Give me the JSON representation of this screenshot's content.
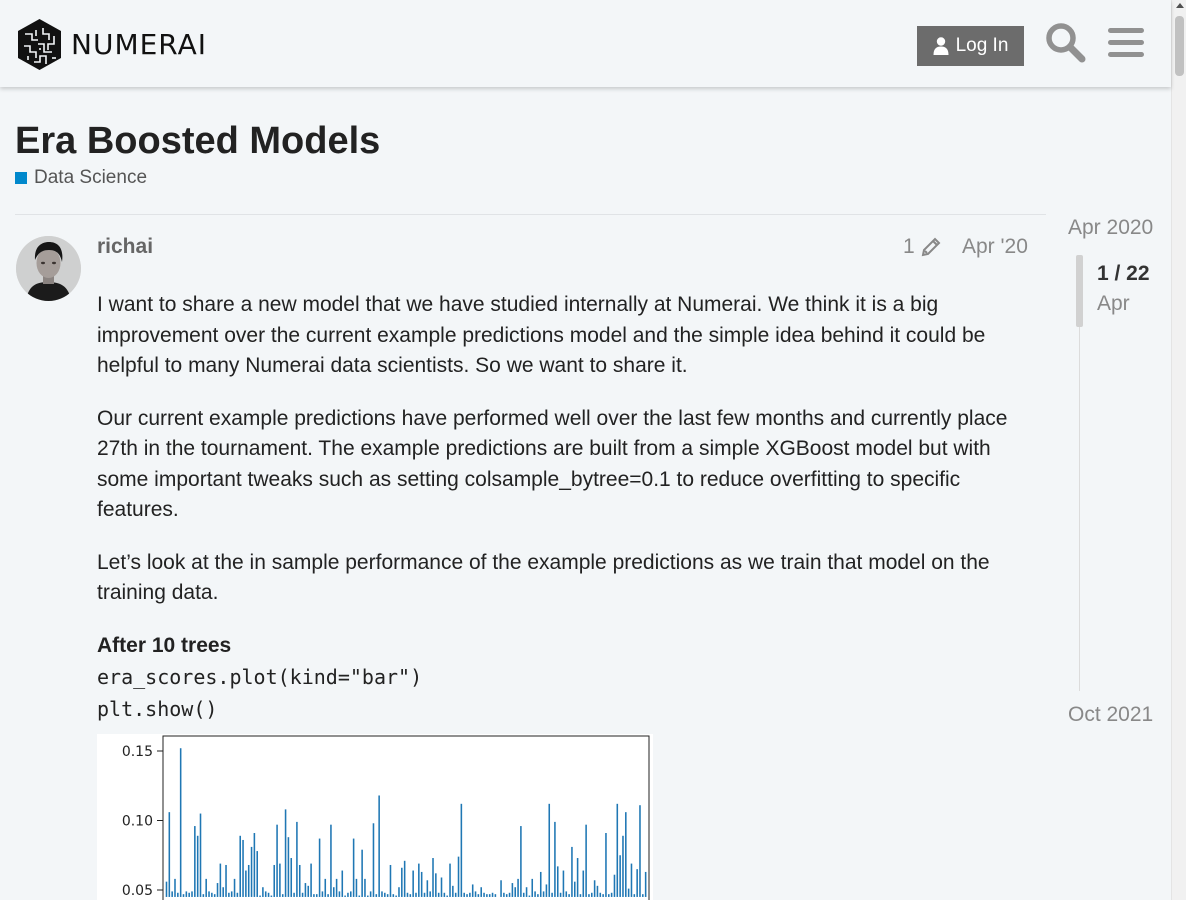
{
  "header": {
    "logo_text": "NUMERAI",
    "login_label": "Log In",
    "icons": [
      "numerai-logo-icon",
      "user-icon",
      "search-icon",
      "hamburger-menu-icon"
    ]
  },
  "topic": {
    "title": "Era Boosted Models",
    "category": "Data Science",
    "category_color": "#0088cc"
  },
  "post": {
    "username": "richai",
    "edit_count": "1",
    "date": "Apr '20",
    "paragraphs": [
      "I want to share a new model that we have studied internally at Numerai. We think it is a big improvement over the current example predictions model and the simple idea behind it could be helpful to many Numerai data scientists. So we want to share it.",
      "Our current example predictions have performed well over the last few months and currently place 27th in the tournament. The example predictions are built from a simple XGBoost model but with some important tweaks such as setting colsample_bytree=0.1 to reduce overfitting to specific features.",
      "Let’s look at the in sample performance of the example predictions as we train that model on the training data."
    ],
    "subheading": "After 10 trees",
    "code_lines": [
      "era_scores.plot(kind=\"bar\")",
      "plt.show()"
    ]
  },
  "timeline": {
    "start": "Apr 2020",
    "position": "1 / 22",
    "current_month": "Apr",
    "end": "Oct 2021"
  },
  "colors": {
    "background": "#f3f6f8",
    "button": "#6c6c6c",
    "bar": "#1f77b4"
  },
  "chart_data": {
    "type": "bar",
    "title": "",
    "xlabel": "",
    "ylabel": "",
    "ylim": [
      0.045,
      0.157
    ],
    "yticks": [
      "0.15",
      "0.10",
      "0.05"
    ],
    "values": [
      0.056,
      0.106,
      0.049,
      0.058,
      0.048,
      0.152,
      0.047,
      0.049,
      0.048,
      0.049,
      0.096,
      0.089,
      0.105,
      0.047,
      0.058,
      0.049,
      0.048,
      0.047,
      0.055,
      0.069,
      0.052,
      0.068,
      0.048,
      0.049,
      0.058,
      0.048,
      0.089,
      0.086,
      0.064,
      0.068,
      0.081,
      0.091,
      0.078,
      0.046,
      0.052,
      0.049,
      0.048,
      0.046,
      0.068,
      0.097,
      0.069,
      0.047,
      0.108,
      0.088,
      0.073,
      0.048,
      0.099,
      0.068,
      0.048,
      0.055,
      0.053,
      0.069,
      0.047,
      0.047,
      0.087,
      0.049,
      0.058,
      0.047,
      0.097,
      0.052,
      0.058,
      0.049,
      0.064,
      0.046,
      0.048,
      0.049,
      0.087,
      0.058,
      0.046,
      0.079,
      0.058,
      0.046,
      0.049,
      0.098,
      0.047,
      0.118,
      0.049,
      0.048,
      0.047,
      0.068,
      0.047,
      0.046,
      0.052,
      0.066,
      0.071,
      0.048,
      0.047,
      0.064,
      0.048,
      0.069,
      0.063,
      0.048,
      0.057,
      0.049,
      0.073,
      0.062,
      0.048,
      0.059,
      0.048,
      0.046,
      0.069,
      0.053,
      0.048,
      0.074,
      0.112,
      0.048,
      0.047,
      0.048,
      0.054,
      0.049,
      0.047,
      0.052,
      0.048,
      0.047,
      0.047,
      0.048,
      0.047,
      0.045,
      0.057,
      0.048,
      0.047,
      0.048,
      0.055,
      0.052,
      0.058,
      0.096,
      0.048,
      0.052,
      0.046,
      0.058,
      0.049,
      0.047,
      0.063,
      0.049,
      0.054,
      0.112,
      0.048,
      0.099,
      0.067,
      0.048,
      0.064,
      0.049,
      0.047,
      0.081,
      0.056,
      0.073,
      0.047,
      0.064,
      0.097,
      0.047,
      0.048,
      0.057,
      0.053,
      0.048,
      0.047,
      0.091,
      0.047,
      0.048,
      0.061,
      0.112,
      0.075,
      0.089,
      0.106,
      0.051,
      0.069,
      0.047,
      0.065,
      0.111,
      0.047,
      0.063
    ]
  }
}
